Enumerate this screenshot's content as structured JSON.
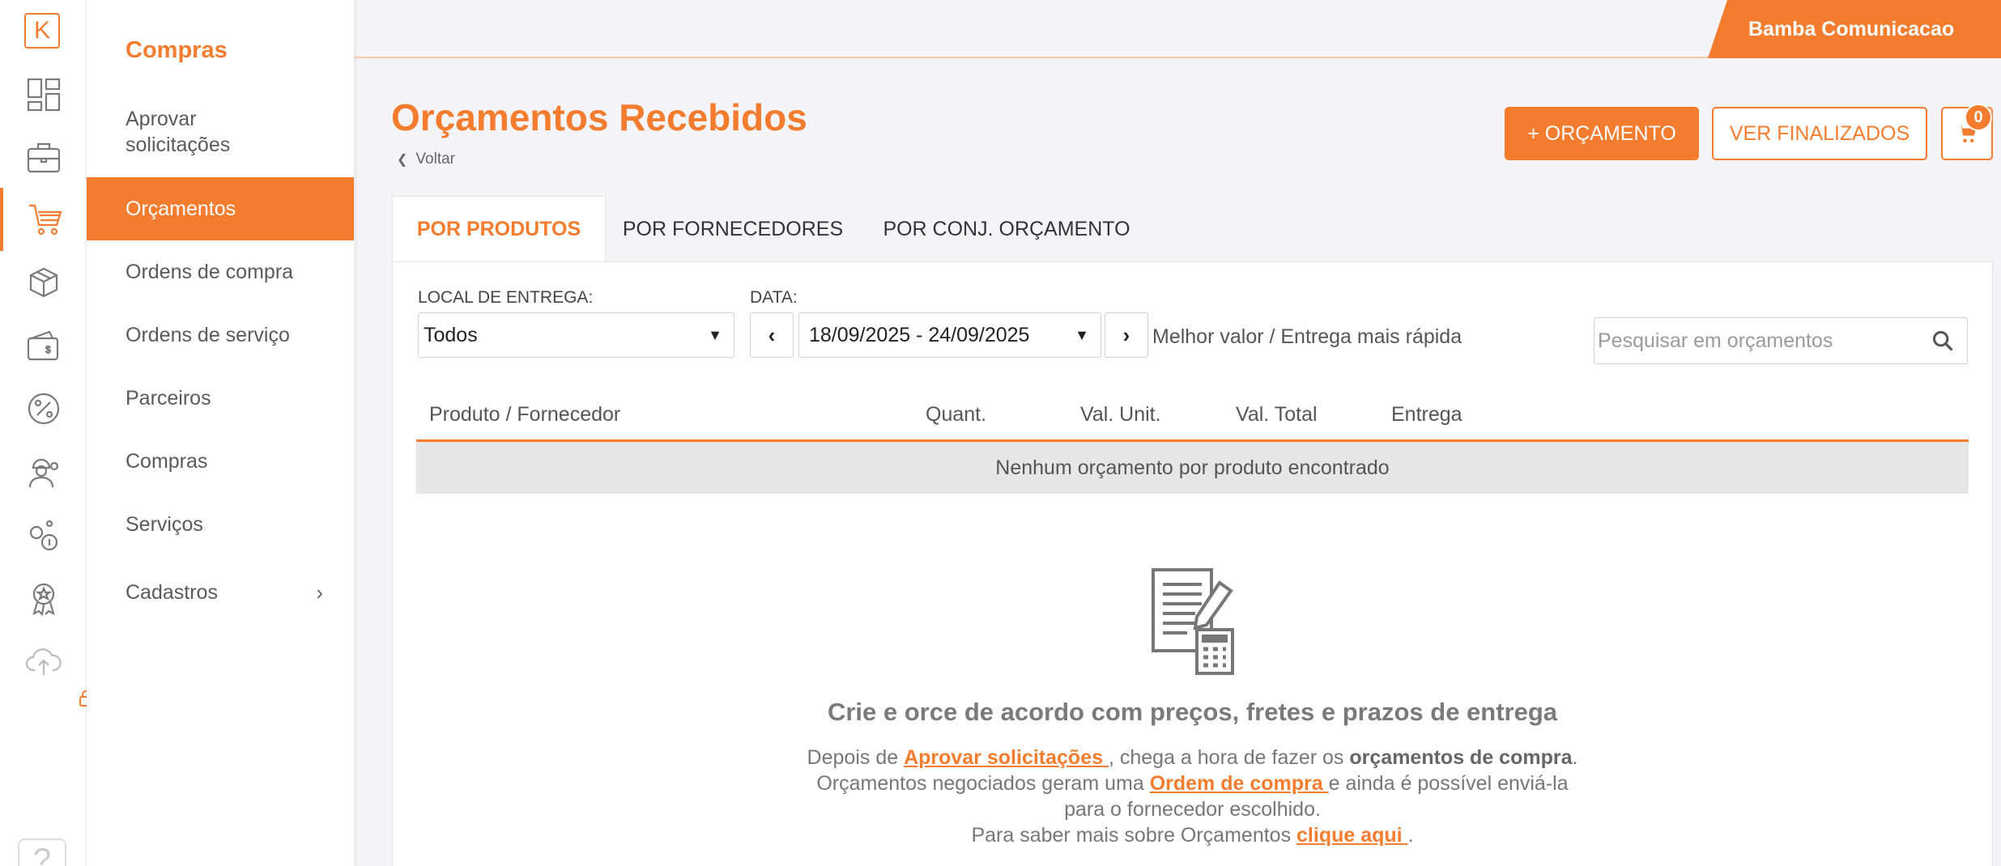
{
  "colors": {
    "accent": "#f47c2e",
    "sidebar_bg": "#ffffff",
    "page_bg": "#f4f4f6",
    "empty_row_bg": "#e6e6e6"
  },
  "rail": {
    "logo": "K",
    "items": [
      {
        "icon": "dashboard-grid-icon"
      },
      {
        "icon": "briefcase-icon"
      },
      {
        "icon": "shopping-cart-icon",
        "active": true
      },
      {
        "icon": "boxes-icon"
      },
      {
        "icon": "wallet-icon"
      },
      {
        "icon": "percent-icon"
      },
      {
        "icon": "worker-icon"
      },
      {
        "icon": "people-network-icon"
      },
      {
        "icon": "award-badge-icon"
      },
      {
        "icon": "cloud-upload-icon"
      }
    ],
    "help": "?"
  },
  "subnav": {
    "title": "Compras",
    "items": [
      {
        "label": "Aprovar solicitações"
      },
      {
        "label": "Orçamentos",
        "active": true
      },
      {
        "label": "Ordens de compra"
      },
      {
        "label": "Ordens de serviço"
      },
      {
        "label": "Parceiros"
      },
      {
        "label": "Compras"
      },
      {
        "label": "Serviços"
      },
      {
        "label": "Cadastros",
        "chevron": "›"
      }
    ]
  },
  "topbar": {
    "company": "Bamba Comunicacao"
  },
  "header": {
    "title": "Orçamentos Recebidos",
    "back": "Voltar",
    "new_budget_button": "+ ORÇAMENTO",
    "finished_button": "VER FINALIZADOS",
    "cart_count": "0"
  },
  "tabs": [
    {
      "label": "POR PRODUTOS",
      "active": true
    },
    {
      "label": "POR FORNECEDORES"
    },
    {
      "label": "POR CONJ. ORÇAMENTO"
    }
  ],
  "filters": {
    "delivery_label": "LOCAL DE ENTREGA:",
    "delivery_value": "Todos",
    "date_label": "DATA:",
    "date_value": "18/09/2025 - 24/09/2025",
    "best_value_label": "Melhor valor / Entrega mais rápida",
    "search_placeholder": "Pesquisar em orçamentos"
  },
  "table": {
    "columns": [
      "Produto / Fornecedor",
      "Quant.",
      "Val. Unit.",
      "Val. Total",
      "Entrega"
    ],
    "empty_message": "Nenhum orçamento por produto encontrado"
  },
  "empty_state": {
    "title": "Crie e orce de acordo com preços, fretes e prazos de entrega",
    "line1_pre": "Depois de ",
    "line1_link": "Aprovar solicitações ",
    "line1_mid": ", chega a hora de fazer os ",
    "line1_bold": "orçamentos de compra",
    "line1_end": ".",
    "line2_pre": "Orçamentos negociados geram uma ",
    "line2_link": "Ordem de compra ",
    "line2_end": "e ainda é possível enviá-la",
    "line3": "para o fornecedor escolhido.",
    "line4_pre": "Para saber mais sobre Orçamentos ",
    "line4_link": "clique aqui ",
    "line4_end": "."
  }
}
